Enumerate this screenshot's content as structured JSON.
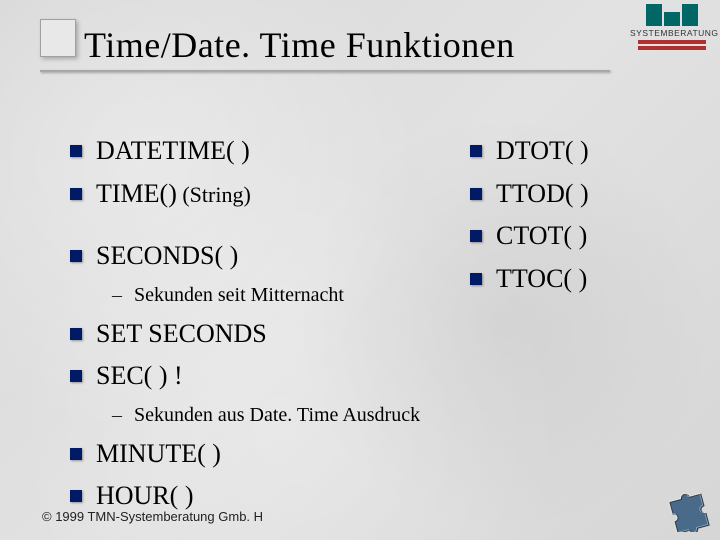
{
  "title": "Time/Date. Time Funktionen",
  "logo": {
    "subtext": "SYSTEMBERATUNG"
  },
  "left_items": [
    {
      "text": "DATETIME( )"
    },
    {
      "text": "TIME()",
      "tail": " (String)"
    },
    {
      "text": "SECONDS( )",
      "sub": [
        "Sekunden seit Mitternacht"
      ]
    },
    {
      "text": "SET SECONDS"
    },
    {
      "text": "SEC( ) !",
      "sub": [
        "Sekunden aus Date. Time Ausdruck"
      ]
    },
    {
      "text": "MINUTE( )"
    },
    {
      "text": "HOUR( )"
    }
  ],
  "right_items": [
    {
      "text": "DTOT( )"
    },
    {
      "text": "TTOD( )"
    },
    {
      "text": "CTOT( )"
    },
    {
      "text": "TTOC( )"
    }
  ],
  "copyright": "© 1999 TMN-Systemberatung Gmb. H"
}
